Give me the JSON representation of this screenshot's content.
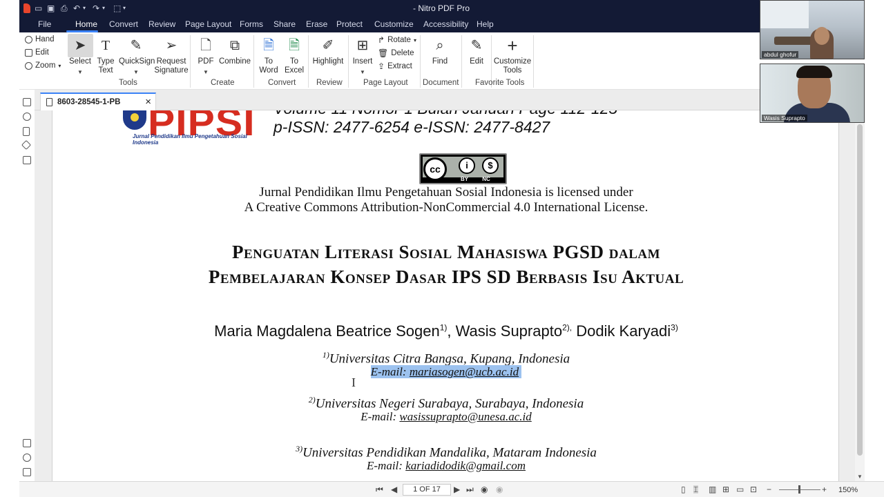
{
  "window": {
    "title": "- Nitro PDF Pro"
  },
  "menu": {
    "items": [
      "File",
      "Home",
      "Convert",
      "Review",
      "Page Layout",
      "Forms",
      "Share",
      "Erase",
      "Protect",
      "Customize",
      "Accessibility",
      "Help"
    ],
    "active": "Home"
  },
  "ribbon": {
    "hand": "Hand",
    "edit_small": "Edit",
    "zoom": "Zoom",
    "select": "Select",
    "type_text_1": "Type",
    "type_text_2": "Text",
    "quicksign": "QuickSign",
    "request_sig_1": "Request",
    "request_sig_2": "Signature",
    "pdf": "PDF",
    "combine": "Combine",
    "to_word_1": "To",
    "to_word_2": "Word",
    "to_excel_1": "To",
    "to_excel_2": "Excel",
    "highlight": "Highlight",
    "insert": "Insert",
    "rotate": "Rotate",
    "delete": "Delete",
    "extract": "Extract",
    "find": "Find",
    "edit": "Edit",
    "customize_1": "Customize",
    "customize_2": "Tools",
    "groups": {
      "tools": "Tools",
      "create": "Create",
      "convert": "Convert",
      "review": "Review",
      "page_layout": "Page Layout",
      "document": "Document",
      "favorite": "Favorite Tools"
    }
  },
  "tab": {
    "name": "8603-28545-1-PB",
    "close": "×"
  },
  "document": {
    "logo_word": "PIPSI",
    "logo_sub": "Jurnal Pendidikan Ilmu Pengetahuan Sosial Indonesia",
    "header_top": "Volume 11 Nomor 1 Bulan Januari Page 112-125",
    "issn": "p-ISSN: 2477-6254    e-ISSN: 2477-8427",
    "cc": {
      "by": "BY",
      "nc": "NC"
    },
    "license_1": "Jurnal Pendidikan Ilmu Pengetahuan Sosial Indonesia is licensed under",
    "license_2": "A Creative Commons Attribution-NonCommercial 4.0 International License.",
    "title_1": "Penguatan Literasi Sosial Mahasiswa PGSD dalam",
    "title_2": "Pembelajaran Konsep Dasar IPS SD Berbasis Isu Aktual",
    "author_1": "Maria Magdalena Beatrice Sogen",
    "author_1_sup": "1)",
    "author_2": ", Wasis Suprapto",
    "author_2_sup": "2),",
    "author_3": " Dodik Karyadi",
    "author_3_sup": "3)",
    "affil_1_sup": "1)",
    "affil_1": "Universitas Citra Bangsa, Kupang, Indonesia",
    "email_1_label": "E-mail: ",
    "email_1": "mariasogen@ucb.ac.id",
    "affil_2_sup": "2)",
    "affil_2": "Universitas Negeri Surabaya, Surabaya, Indonesia",
    "email_2_label": "E-mail: ",
    "email_2": "wasissuprapto@unesa.ac.id",
    "affil_3_sup": "3)",
    "affil_3": "Universitas Pendidikan Mandalika, Mataram Indonesia",
    "email_3_label": "E-mail: ",
    "email_3": "kariadidodik@gmail.com"
  },
  "status": {
    "page_indicator": "1 OF 17",
    "zoom": "150%"
  },
  "participants": [
    {
      "name": "abdul ghofur"
    },
    {
      "name": "Wasis Suprapto"
    }
  ],
  "colors": {
    "titlebar": "#131a35",
    "accent": "#3b82f6",
    "logo_red": "#d62d20",
    "selection": "#9cc2ef"
  }
}
